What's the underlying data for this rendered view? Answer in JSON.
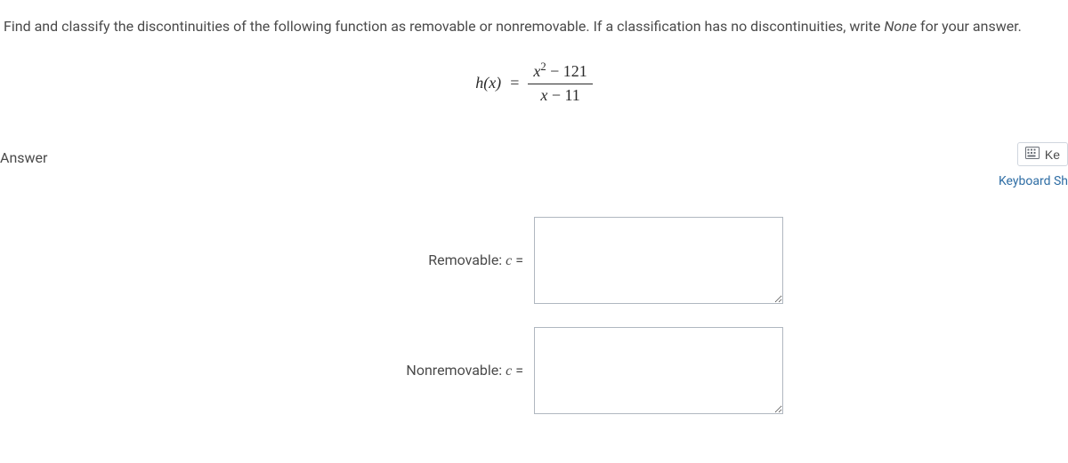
{
  "question": {
    "prompt_pre": "Find and classify the discontinuities of the following function as removable or nonremovable. If a classification has no discontinuities, write ",
    "prompt_italic": "None",
    "prompt_post": " for your answer."
  },
  "equation": {
    "lhs": "h(x)",
    "equals": "=",
    "numerator_var": "x",
    "numerator_exp": "2",
    "numerator_minus": " − ",
    "numerator_const": "121",
    "denominator_var": "x",
    "denominator_minus": " − ",
    "denominator_const": "11"
  },
  "answer_section": {
    "heading": "Answer",
    "keypad_label": "Ke",
    "keyboard_shortcut_label": "Keyboard Sh"
  },
  "inputs": {
    "removable_label_pre": "Removable: ",
    "removable_var": "c",
    "removable_eq": " =",
    "removable_value": "",
    "nonremovable_label_pre": "Nonremovable: ",
    "nonremovable_var": "c",
    "nonremovable_eq": " =",
    "nonremovable_value": ""
  }
}
